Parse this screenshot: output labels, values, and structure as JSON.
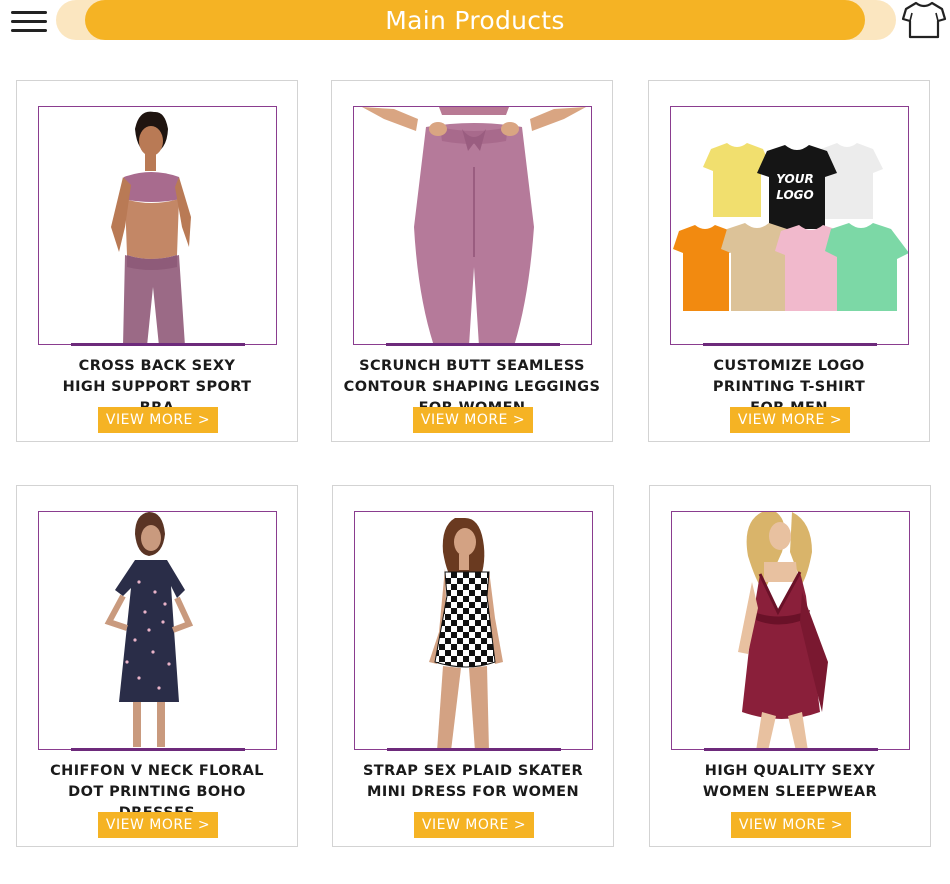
{
  "header": {
    "title": "Main Products",
    "menu_icon": "hamburger-menu-icon",
    "cart_icon": "tshirt-icon",
    "accent_color": "#f5b324",
    "frame_color": "#8a3d8f"
  },
  "products": [
    {
      "title": "CROSS BACK SEXY HIGH SUPPORT SPORT BRA",
      "button": "VIEW MORE >"
    },
    {
      "title": "SCRUNCH BUTT SEAMLESS CONTOUR SHAPING LEGGINGS FOR WOMEN",
      "button": "VIEW MORE >"
    },
    {
      "title": "CUSTOMIZE LOGO PRINTING T-SHIRT FOR MEN",
      "button": "VIEW MORE >",
      "logo_text_1": "YOUR",
      "logo_text_2": "LOGO"
    },
    {
      "title": "CHIFFON V NECK FLORAL DOT PRINTING BOHO DRESSES",
      "button": "VIEW MORE >"
    },
    {
      "title": "STRAP SEX PLAID SKATER MINI DRESS FOR WOMEN",
      "button": "VIEW MORE >"
    },
    {
      "title": "HIGH QUALITY SEXY WOMEN SLEEPWEAR",
      "button": "VIEW MORE >"
    }
  ]
}
